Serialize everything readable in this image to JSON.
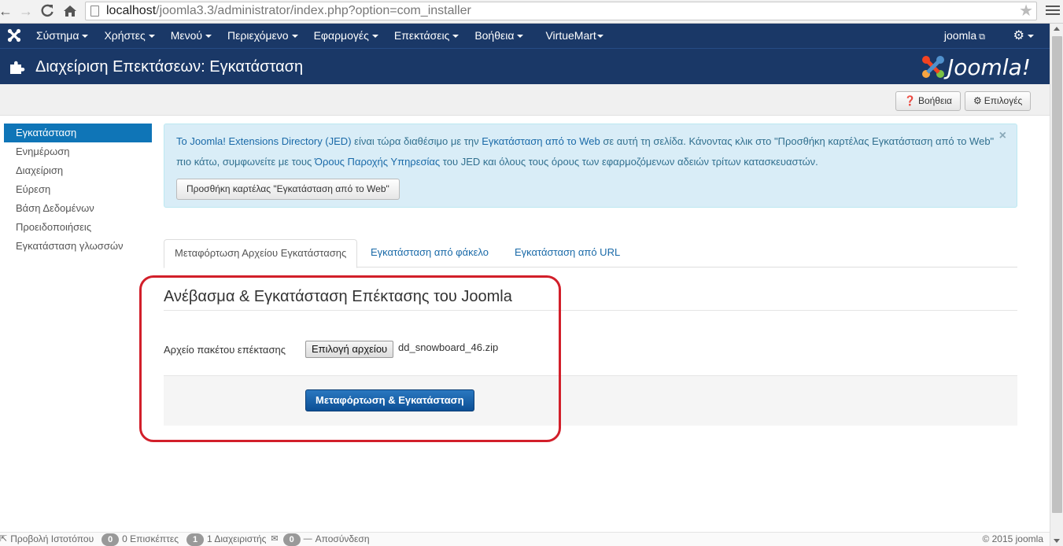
{
  "browser": {
    "url_host": "localhost",
    "url_path": "/joomla3.3/administrator/index.php?option=com_installer"
  },
  "navbar": {
    "menu": [
      {
        "label": "Σύστημα",
        "caret": true
      },
      {
        "label": "Χρήστες",
        "caret": true
      },
      {
        "label": "Μενού",
        "caret": true
      },
      {
        "label": "Περιεχόμενο",
        "caret": true
      },
      {
        "label": "Εφαρμογές",
        "caret": true
      },
      {
        "label": "Επεκτάσεις",
        "caret": true
      },
      {
        "label": "Βοήθεια",
        "caret": true
      },
      {
        "label": "VirtueMart",
        "caret": true
      }
    ],
    "user": "joomla"
  },
  "header": {
    "title": "Διαχείριση Επεκτάσεων: Εγκατάσταση",
    "logo_text": "Joomla!"
  },
  "toolbar": {
    "help_label": "Βοήθεια",
    "options_label": "Επιλογές"
  },
  "sidebar": {
    "items": [
      {
        "label": "Εγκατάσταση",
        "active": true
      },
      {
        "label": "Ενημέρωση",
        "active": false
      },
      {
        "label": "Διαχείριση",
        "active": false
      },
      {
        "label": "Εύρεση",
        "active": false
      },
      {
        "label": "Βάση Δεδομένων",
        "active": false
      },
      {
        "label": "Προειδοποιήσεις",
        "active": false
      },
      {
        "label": "Εγκατάσταση γλωσσών",
        "active": false
      }
    ]
  },
  "alert": {
    "link1": "Το Joomla! Extensions Directory (JED)",
    "text1": " είναι τώρα διαθέσιμο με την ",
    "link2": "Εγκατάσταση από το Web",
    "text2": " σε αυτή τη σελίδα.  Κάνοντας κλικ στο \"Προσθήκη καρτέλας Εγκατάσταση από το Web\" πιο κάτω, συμφωνείτε με τους ",
    "link3": "Όρους Παροχής Υπηρεσίας",
    "text3": " του JED και όλους τους όρους των εφαρμοζόμενων αδειών τρίτων κατασκευαστών.",
    "close": "×",
    "button_label": "Προσθήκη καρτέλας \"Εγκατάσταση από το Web\""
  },
  "tabs": [
    {
      "label": "Μεταφόρτωση Αρχείου Εγκατάστασης",
      "active": true
    },
    {
      "label": "Εγκατάσταση από φάκελο",
      "active": false
    },
    {
      "label": "Εγκατάσταση από URL",
      "active": false
    }
  ],
  "upload": {
    "title": "Ανέβασμα & Εγκατάσταση Επέκτασης του Joomla",
    "field_label": "Αρχείο πακέτου επέκτασης",
    "choose_file_label": "Επιλογή αρχείου",
    "file_name": "dd_snowboard_46.zip",
    "submit_label": "Μεταφόρτωση & Εγκατάσταση"
  },
  "status": {
    "view_site": "Προβολή Ιστοτόπου",
    "visitors_count": "0",
    "visitors_label": "0 Επισκέπτες",
    "admins_count": "1",
    "admins_label": "1 Διαχειριστής",
    "messages_count": "0",
    "logout": "Αποσύνδεση",
    "copyright": "© 2015 joomla"
  },
  "colors": {
    "navbar": "#1a3867",
    "active_sidebar": "#0f75b7",
    "alert_bg": "#d9edf7",
    "primary_button": "#1a62ab",
    "highlight_outline": "#d21f2a"
  }
}
